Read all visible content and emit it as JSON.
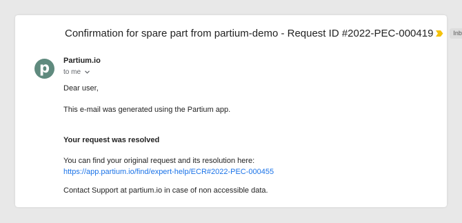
{
  "email": {
    "subject": "Confirmation for spare part from partium-demo - Request ID #2022-PEC-000419",
    "label_badge": "Inbox",
    "label_badge_close": "×",
    "avatar_letter": "p",
    "sender_name": "Partium.io",
    "recipient": "to me",
    "body": {
      "greeting": "Dear user,",
      "intro": "This e-mail was generated using the Partium app.",
      "heading": "Your request was resolved",
      "find_text": "You can find your original request and its resolution here:",
      "link": "https://app.partium.io/find/expert-help/ECR#2022-PEC-000455",
      "support": "Contact Support at partium.io in case of non accessible data."
    }
  },
  "colors": {
    "background": "#e8e8e8",
    "card": "#ffffff",
    "avatar": "#5f8a7e",
    "link": "#1a73e8",
    "important_marker": "#f4c20d",
    "badge": "#dddddd"
  },
  "icons": {
    "important_marker": "important-marker-icon",
    "badge_close": "close-icon",
    "details_toggle": "chevron-down-icon"
  }
}
